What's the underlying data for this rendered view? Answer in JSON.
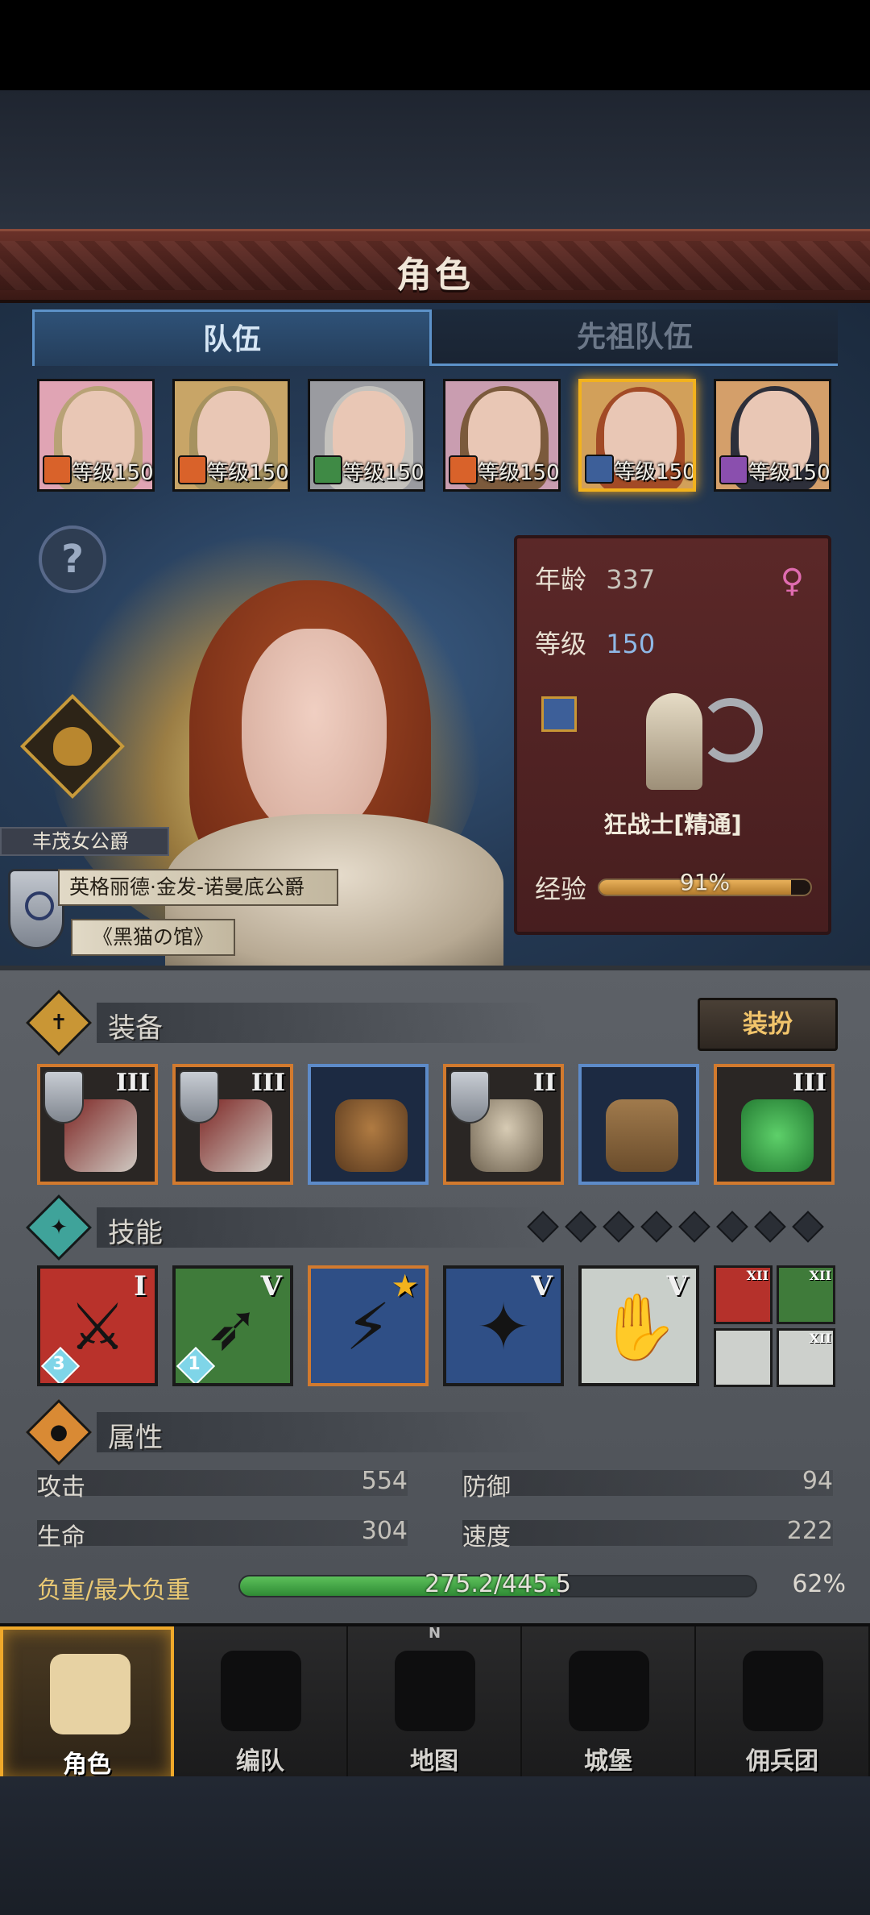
{
  "header": {
    "title": "角色"
  },
  "tabs": [
    {
      "label": "队伍",
      "active": true
    },
    {
      "label": "先祖队伍",
      "active": false
    }
  ],
  "team": [
    {
      "level_label": "等级150",
      "badge_color": "#d9622a",
      "selected": false,
      "hair": "#b8a276",
      "bg": "#e0a4b4"
    },
    {
      "level_label": "等级150",
      "badge_color": "#d9622a",
      "selected": false,
      "hair": "#a6925f",
      "bg": "#c8a567"
    },
    {
      "level_label": "等级150",
      "badge_color": "#3f8a45",
      "selected": false,
      "hair": "#c4c2bd",
      "bg": "#9a9ba0"
    },
    {
      "level_label": "等级150",
      "badge_color": "#d9622a",
      "selected": false,
      "hair": "#7b5a3c",
      "bg": "#c99db0"
    },
    {
      "level_label": "等级150",
      "badge_color": "#3d5f99",
      "selected": true,
      "hair": "#a24a26",
      "bg": "#d2a05a"
    },
    {
      "level_label": "等级150",
      "badge_color": "#8a4fae",
      "selected": false,
      "hair": "#2d2f3a",
      "bg": "#d49f6a"
    }
  ],
  "hero": {
    "nickname": "丰茂女公爵",
    "full_title": "英格丽德·金发-诺曼底公爵",
    "guild": "《黑猫の馆》"
  },
  "info": {
    "age_label": "年龄",
    "age": "337",
    "gender_icon": "♀",
    "level_label": "等级",
    "level": "150",
    "class_name": "狂战士[精通]",
    "exp_label": "经验",
    "exp_percent_text": "91%",
    "exp_fraction": 0.91
  },
  "equipment": {
    "label": "装备",
    "dress_button": "装扮",
    "slots": [
      {
        "name": "weapon-main",
        "tier": "III",
        "rarity": "orange",
        "shield": true
      },
      {
        "name": "weapon-off",
        "tier": "III",
        "rarity": "orange",
        "shield": true
      },
      {
        "name": "helmet",
        "tier": "",
        "rarity": "blue",
        "shield": false
      },
      {
        "name": "armor",
        "tier": "II",
        "rarity": "orange",
        "shield": true
      },
      {
        "name": "boots",
        "tier": "",
        "rarity": "blue",
        "shield": false
      },
      {
        "name": "trinket",
        "tier": "III",
        "rarity": "orange",
        "shield": false
      }
    ]
  },
  "skills": {
    "label": "技能",
    "slots_total": 8,
    "items": [
      {
        "tier": "I",
        "bg": "#b9322b",
        "count": "3",
        "border": "#1a1a1a"
      },
      {
        "tier": "V",
        "bg": "#3f7b3a",
        "count": "1",
        "border": "#1a1a1a"
      },
      {
        "tier": "★",
        "bg": "#2f4f86",
        "count": "",
        "border": "#d27a2e"
      },
      {
        "tier": "V",
        "bg": "#2f4f86",
        "count": "",
        "border": "#1a1a1a"
      },
      {
        "tier": "V",
        "bg": "#c9cfca",
        "count": "",
        "border": "#1a1a1a"
      }
    ],
    "mini": [
      {
        "tier": "XII",
        "bg": "#b5312b"
      },
      {
        "tier": "XII",
        "bg": "#3f7b3a"
      },
      {
        "tier": "",
        "bg": "#cdd0cc"
      },
      {
        "tier": "XII",
        "bg": "#cdd0cc"
      }
    ]
  },
  "attributes": {
    "label": "属性",
    "attack_label": "攻击",
    "attack": "554",
    "defense_label": "防御",
    "defense": "94",
    "hp_label": "生命",
    "hp": "304",
    "speed_label": "速度",
    "speed": "222",
    "weight_label": "负重/最大负重",
    "weight_text": "275.2/445.5",
    "weight_percent_text": "62%",
    "weight_fraction": 0.62
  },
  "nav": [
    {
      "label": "角色",
      "active": true
    },
    {
      "label": "编队",
      "active": false
    },
    {
      "label": "地图",
      "active": false
    },
    {
      "label": "城堡",
      "active": false
    },
    {
      "label": "佣兵团",
      "active": false
    }
  ],
  "colors": {
    "accent": "#f2b21d",
    "tab_border": "#5d92c9",
    "banner": "#5b2a24"
  }
}
